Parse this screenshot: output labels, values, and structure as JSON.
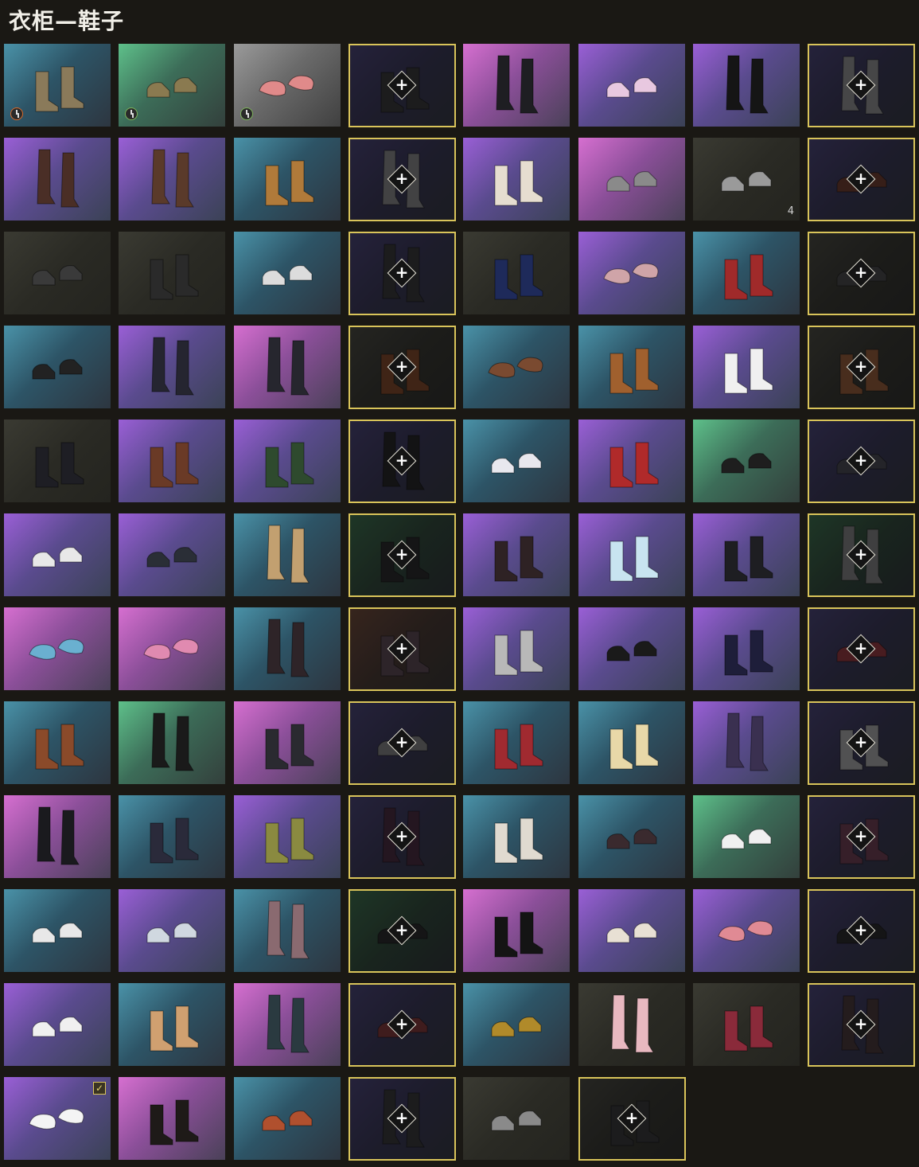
{
  "header": {
    "title": "衣柜—鞋子"
  },
  "colors": {
    "locked_border": "#d9c45a",
    "background": "#1a1814"
  },
  "tiles": [
    {
      "bg": "blue",
      "shoe": "#8a7a5a",
      "kind": "boot",
      "badge": "clock-orange"
    },
    {
      "bg": "green",
      "shoe": "#8a7a50",
      "kind": "sneaker",
      "badge": "clock-green"
    },
    {
      "bg": "gray",
      "shoe": "#e08a8a",
      "kind": "slipper",
      "badge": "clock-green"
    },
    {
      "bg": "darkpurple",
      "shoe": "#2a2a2a",
      "kind": "boot",
      "locked": true
    },
    {
      "bg": "pink",
      "shoe": "#1e1e22",
      "kind": "tallboot"
    },
    {
      "bg": "purple",
      "shoe": "#e8c8e0",
      "kind": "sneaker"
    },
    {
      "bg": "purple",
      "shoe": "#151515",
      "kind": "tallboot"
    },
    {
      "bg": "darkpurple",
      "shoe": "#777777",
      "kind": "tallboot",
      "locked": true
    },
    {
      "bg": "purple",
      "shoe": "#4a2e26",
      "kind": "tallboot"
    },
    {
      "bg": "purple",
      "shoe": "#5a3a2a",
      "kind": "tallboot"
    },
    {
      "bg": "blue",
      "shoe": "#b07a3a",
      "kind": "boot"
    },
    {
      "bg": "darkpurple",
      "shoe": "#707070",
      "kind": "tallboot",
      "locked": true
    },
    {
      "bg": "purple",
      "shoe": "#e6ddd0",
      "kind": "boot"
    },
    {
      "bg": "pink",
      "shoe": "#8a8a8a",
      "kind": "sneaker"
    },
    {
      "bg": "dark",
      "shoe": "#9a9a9a",
      "kind": "sneaker",
      "count": "4"
    },
    {
      "bg": "darkpurple",
      "shoe": "#5a2e22",
      "kind": "sneaker",
      "locked": true
    },
    {
      "bg": "dark",
      "shoe": "#3a3a3a",
      "kind": "sneaker"
    },
    {
      "bg": "dark",
      "shoe": "#2a2a2a",
      "kind": "boot"
    },
    {
      "bg": "blue",
      "shoe": "#dcdcdc",
      "kind": "sneaker"
    },
    {
      "bg": "darkpurple",
      "shoe": "#2a2a2a",
      "kind": "tallboot",
      "locked": true
    },
    {
      "bg": "dark",
      "shoe": "#1e2a5a",
      "kind": "boot"
    },
    {
      "bg": "purple",
      "shoe": "#cfa4a8",
      "kind": "slipper"
    },
    {
      "bg": "blue",
      "shoe": "#a02a2a",
      "kind": "boot"
    },
    {
      "bg": "dark",
      "shoe": "#3a3a3a",
      "kind": "sneaker",
      "locked": true
    },
    {
      "bg": "blue",
      "shoe": "#222222",
      "kind": "sneaker"
    },
    {
      "bg": "purple",
      "shoe": "#252530",
      "kind": "tallboot"
    },
    {
      "bg": "pink",
      "shoe": "#26262e",
      "kind": "tallboot"
    },
    {
      "bg": "dark",
      "shoe": "#6a3a1e",
      "kind": "boot",
      "locked": true
    },
    {
      "bg": "blue",
      "shoe": "#7a4a30",
      "kind": "slipper"
    },
    {
      "bg": "blue",
      "shoe": "#a0602e",
      "kind": "boot"
    },
    {
      "bg": "purple",
      "shoe": "#f0f0f0",
      "kind": "boot"
    },
    {
      "bg": "dark",
      "shoe": "#7a4a2a",
      "kind": "boot",
      "locked": true
    },
    {
      "bg": "dark",
      "shoe": "#1e1e24",
      "kind": "boot"
    },
    {
      "bg": "purple",
      "shoe": "#6a3a26",
      "kind": "boot"
    },
    {
      "bg": "purple",
      "shoe": "#2e4a2e",
      "kind": "boot"
    },
    {
      "bg": "darkpurple",
      "shoe": "#1a1a1a",
      "kind": "tallboot",
      "locked": true
    },
    {
      "bg": "blue",
      "shoe": "#e8e8ee",
      "kind": "sneaker"
    },
    {
      "bg": "purple",
      "shoe": "#b02a2a",
      "kind": "boot"
    },
    {
      "bg": "green",
      "shoe": "#1e1e1e",
      "kind": "sneaker"
    },
    {
      "bg": "darkpurple",
      "shoe": "#3a3a40",
      "kind": "sneaker",
      "locked": true
    },
    {
      "bg": "purple",
      "shoe": "#e8e8e8",
      "kind": "sneaker"
    },
    {
      "bg": "purple",
      "shoe": "#2a2e36",
      "kind": "sneaker"
    },
    {
      "bg": "blue",
      "shoe": "#c2a070",
      "kind": "tallboot"
    },
    {
      "bg": "darkgreen",
      "shoe": "#1e1e1e",
      "kind": "boot",
      "locked": true
    },
    {
      "bg": "purple",
      "shoe": "#2e2224",
      "kind": "boot"
    },
    {
      "bg": "purple",
      "shoe": "#c8e4f0",
      "kind": "boot"
    },
    {
      "bg": "purple",
      "shoe": "#1e1e22",
      "kind": "boot"
    },
    {
      "bg": "darkgreen",
      "shoe": "#6a6a6a",
      "kind": "tallboot",
      "locked": true
    },
    {
      "bg": "pink",
      "shoe": "#6ab0d0",
      "kind": "slipper"
    },
    {
      "bg": "pink",
      "shoe": "#e08ab0",
      "kind": "slipper"
    },
    {
      "bg": "blue",
      "shoe": "#2e2428",
      "kind": "tallboot"
    },
    {
      "bg": "darkred",
      "shoe": "#4a3a40",
      "kind": "boot",
      "locked": true
    },
    {
      "bg": "purple",
      "shoe": "#b8b8b8",
      "kind": "boot"
    },
    {
      "bg": "purple",
      "shoe": "#1a1a1a",
      "kind": "sneaker"
    },
    {
      "bg": "purple",
      "shoe": "#1e1e3a",
      "kind": "boot"
    },
    {
      "bg": "darkpurple",
      "shoe": "#7a2a30",
      "kind": "sneaker",
      "locked": true
    },
    {
      "bg": "blue",
      "shoe": "#8a4a2a",
      "kind": "boot"
    },
    {
      "bg": "green",
      "shoe": "#1a1a1a",
      "kind": "tallboot"
    },
    {
      "bg": "pink",
      "shoe": "#2a2a30",
      "kind": "boot"
    },
    {
      "bg": "darkpurple",
      "shoe": "#6a6a6a",
      "kind": "sneaker",
      "locked": true
    },
    {
      "bg": "blue",
      "shoe": "#a02a30",
      "kind": "boot"
    },
    {
      "bg": "blue",
      "shoe": "#e8d8a8",
      "kind": "boot"
    },
    {
      "bg": "purple",
      "shoe": "#3a3050",
      "kind": "tallboot"
    },
    {
      "bg": "darkpurple",
      "shoe": "#8a8a8a",
      "kind": "boot",
      "locked": true
    },
    {
      "bg": "pink",
      "shoe": "#1a1a1e",
      "kind": "tallboot"
    },
    {
      "bg": "blue",
      "shoe": "#2a2a3a",
      "kind": "boot"
    },
    {
      "bg": "purple",
      "shoe": "#8a8a40",
      "kind": "boot"
    },
    {
      "bg": "darkpurple",
      "shoe": "#3a2030",
      "kind": "tallboot",
      "locked": true
    },
    {
      "bg": "blue",
      "shoe": "#e0dad0",
      "kind": "boot"
    },
    {
      "bg": "blue",
      "shoe": "#3a2a2e",
      "kind": "sneaker"
    },
    {
      "bg": "green",
      "shoe": "#f0f0f0",
      "kind": "sneaker"
    },
    {
      "bg": "darkpurple",
      "shoe": "#5a3040",
      "kind": "boot",
      "locked": true
    },
    {
      "bg": "blue",
      "shoe": "#e8e8e8",
      "kind": "sneaker"
    },
    {
      "bg": "purple",
      "shoe": "#d0d8e0",
      "kind": "sneaker"
    },
    {
      "bg": "blue",
      "shoe": "#8a6a70",
      "kind": "tallboot"
    },
    {
      "bg": "darkgreen",
      "shoe": "#1e1e1e",
      "kind": "sneaker",
      "locked": true
    },
    {
      "bg": "pink",
      "shoe": "#141414",
      "kind": "boot"
    },
    {
      "bg": "purple",
      "shoe": "#e8e0d4",
      "kind": "sneaker"
    },
    {
      "bg": "purple",
      "shoe": "#e08a94",
      "kind": "slipper"
    },
    {
      "bg": "darkpurple",
      "shoe": "#1e1e1e",
      "kind": "sneaker",
      "locked": true
    },
    {
      "bg": "purple",
      "shoe": "#f0f0f0",
      "kind": "sneaker"
    },
    {
      "bg": "blue",
      "shoe": "#d0a070",
      "kind": "boot"
    },
    {
      "bg": "pink",
      "shoe": "#2a3a40",
      "kind": "tallboot"
    },
    {
      "bg": "darkpurple",
      "shoe": "#6a2a2a",
      "kind": "sneaker",
      "locked": true
    },
    {
      "bg": "blue",
      "shoe": "#b08a2a",
      "kind": "sneaker"
    },
    {
      "bg": "dark",
      "shoe": "#e8b8c0",
      "kind": "tallboot"
    },
    {
      "bg": "dark",
      "shoe": "#8a2a3a",
      "kind": "boot"
    },
    {
      "bg": "darkpurple",
      "shoe": "#3a2a2a",
      "kind": "tallboot",
      "locked": true
    },
    {
      "bg": "purple",
      "shoe": "#f4f4f4",
      "kind": "slipper",
      "check": true
    },
    {
      "bg": "pink",
      "shoe": "#1e1a18",
      "kind": "boot"
    },
    {
      "bg": "blue",
      "shoe": "#b0502e",
      "kind": "sneaker"
    },
    {
      "bg": "darkpurple",
      "shoe": "#2a2a2a",
      "kind": "tallboot",
      "locked": true
    },
    {
      "bg": "dark",
      "shoe": "#8a8a8a",
      "kind": "sneaker"
    },
    {
      "bg": "dark",
      "shoe": "#2a2a2a",
      "kind": "boot",
      "locked": true
    }
  ]
}
